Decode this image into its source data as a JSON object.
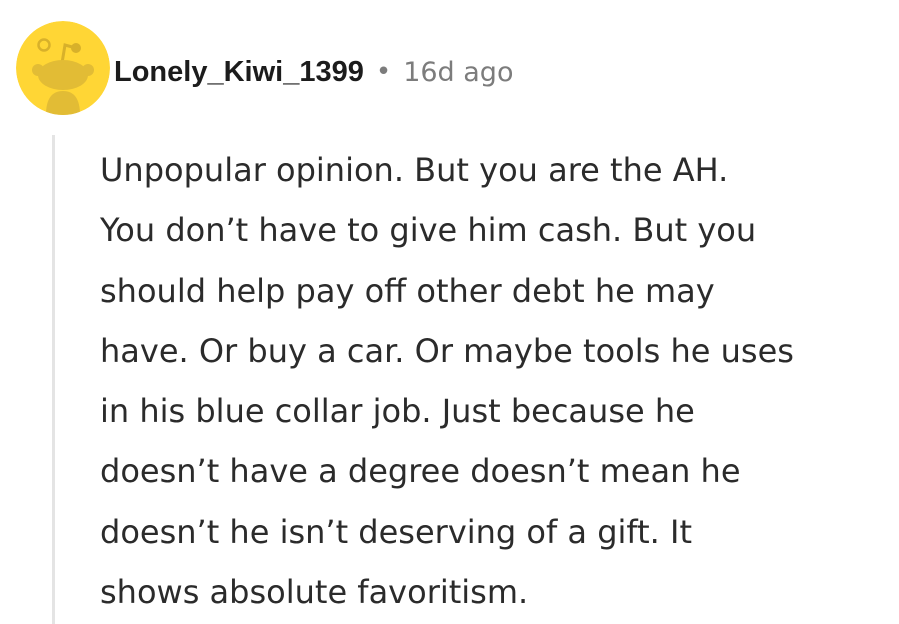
{
  "comment": {
    "author": "Lonely_Kiwi_1399",
    "separator": "•",
    "timestamp": "16d ago",
    "avatar_icon": "snoo-avatar-icon",
    "colors": {
      "avatar_background": "#FFD635",
      "username": "#1C1C1C",
      "meta": "#7C7C7C",
      "body_text": "#2B2B2B",
      "thread_line": "#E4E4E4"
    },
    "body_lines": [
      "Unpopular opinion. But you are the AH.",
      "You don’t have to give him cash. But you",
      "should help pay off other debt he may",
      "have. Or buy a car. Or maybe tools he uses",
      "in his blue collar job. Just because he",
      "doesn’t have a degree doesn’t mean he",
      "doesn’t he isn’t deserving of a gift. It",
      "shows absolute favoritism."
    ]
  }
}
